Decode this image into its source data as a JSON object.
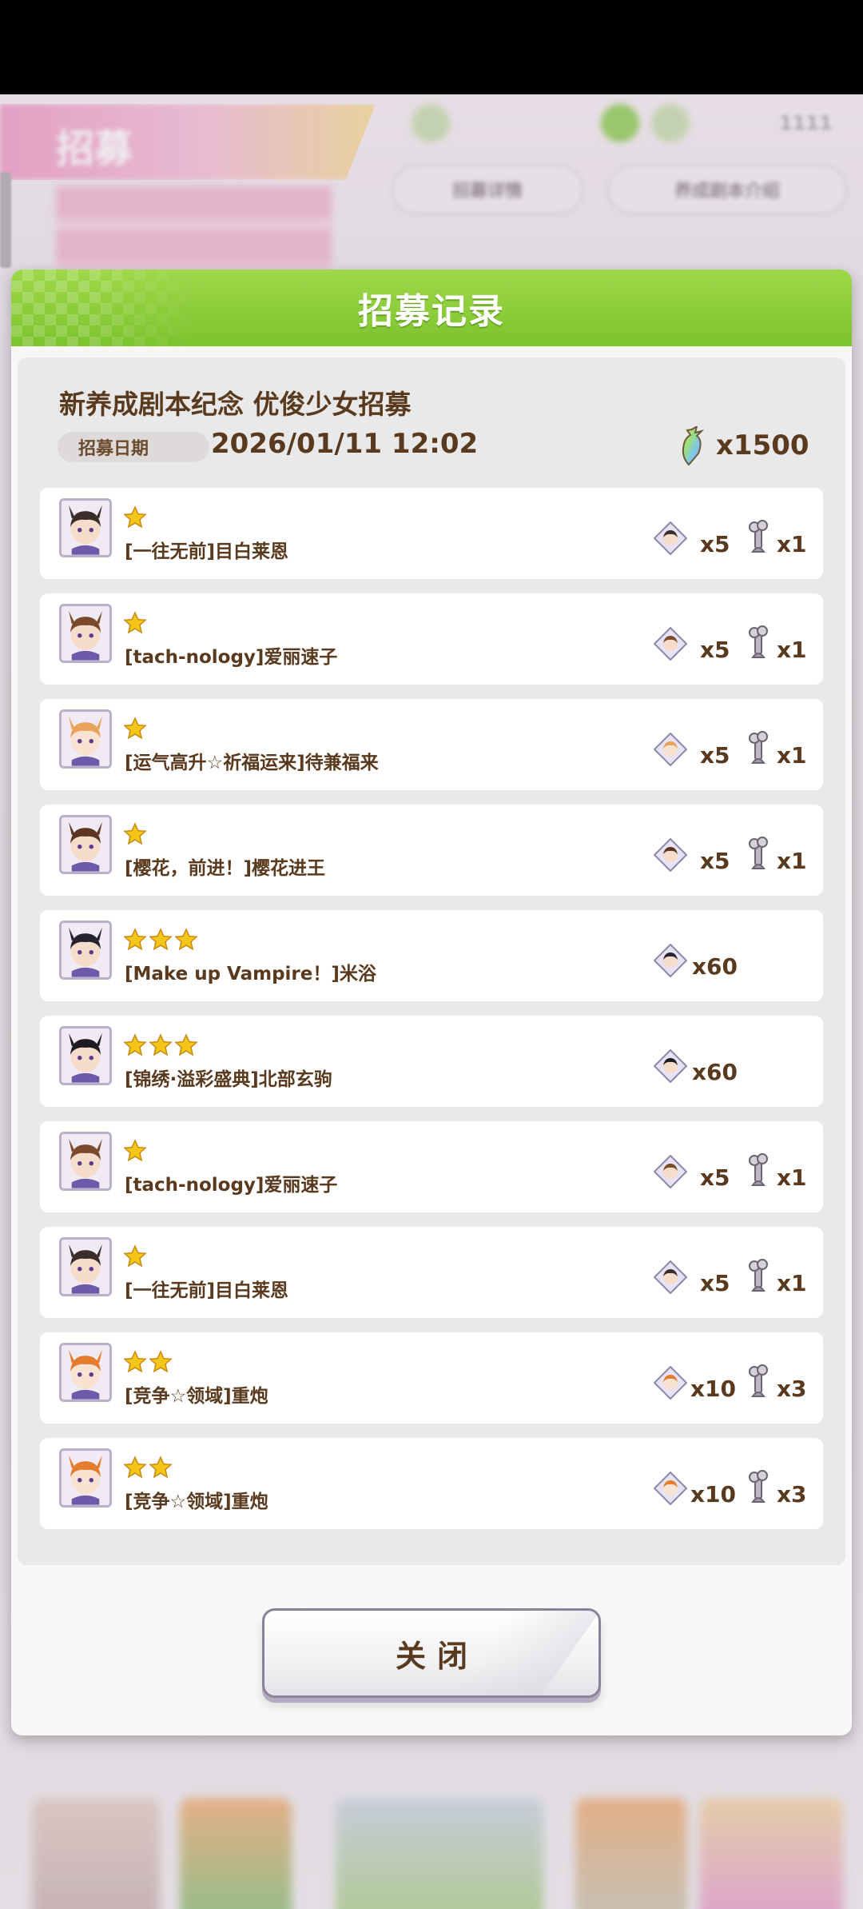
{
  "background": {
    "banner_title": "招募",
    "pill_left": "招募详情",
    "pill_right": "养成剧本介绍"
  },
  "dialog": {
    "title": "招募记录",
    "banner_name": "新养成剧本纪念 优俊少女招募",
    "date_label": "招募日期",
    "date_value": "2026/01/11 12:02",
    "cost_icon": "carrot-jewel-icon",
    "cost_value": "x1500",
    "close_label": "关闭"
  },
  "colors": {
    "header_green": "#8ccc3a",
    "text_brown": "#5a3a1e",
    "star_gold": "#f5c518"
  },
  "results": [
    {
      "stars": 1,
      "title": "[一往无前]目白莱恩",
      "pieces": "x5",
      "bones": "x1",
      "hair": "#3a2d2a",
      "skin": "#f6dccb"
    },
    {
      "stars": 1,
      "title": "[tach-nology]爱丽速子",
      "pieces": "x5",
      "bones": "x1",
      "hair": "#7a4a2a",
      "skin": "#f6dccb"
    },
    {
      "stars": 1,
      "title": "[运气高升☆祈福运来]待兼福来",
      "pieces": "x5",
      "bones": "x1",
      "hair": "#e8a25a",
      "skin": "#f8e2d2"
    },
    {
      "stars": 1,
      "title": "[樱花，前进！]樱花进王",
      "pieces": "x5",
      "bones": "x1",
      "hair": "#5b3422",
      "skin": "#f6dccb"
    },
    {
      "stars": 3,
      "title": "[Make up Vampire！]米浴",
      "pieces": "x60",
      "bones": "",
      "hair": "#262230",
      "skin": "#f6dccb"
    },
    {
      "stars": 3,
      "title": "[锦绣·溢彩盛典]北部玄驹",
      "pieces": "x60",
      "bones": "",
      "hair": "#1e1c22",
      "skin": "#f6dccb"
    },
    {
      "stars": 1,
      "title": "[tach-nology]爱丽速子",
      "pieces": "x5",
      "bones": "x1",
      "hair": "#7a4a2a",
      "skin": "#f6dccb"
    },
    {
      "stars": 1,
      "title": "[一往无前]目白莱恩",
      "pieces": "x5",
      "bones": "x1",
      "hair": "#3a2d2a",
      "skin": "#f6dccb"
    },
    {
      "stars": 2,
      "title": "[竞争☆领域]重炮",
      "pieces": "x10",
      "bones": "x3",
      "hair": "#e57b2c",
      "skin": "#f8e2d2"
    },
    {
      "stars": 2,
      "title": "[竞争☆领域]重炮",
      "pieces": "x10",
      "bones": "x3",
      "hair": "#e57b2c",
      "skin": "#f8e2d2"
    }
  ]
}
